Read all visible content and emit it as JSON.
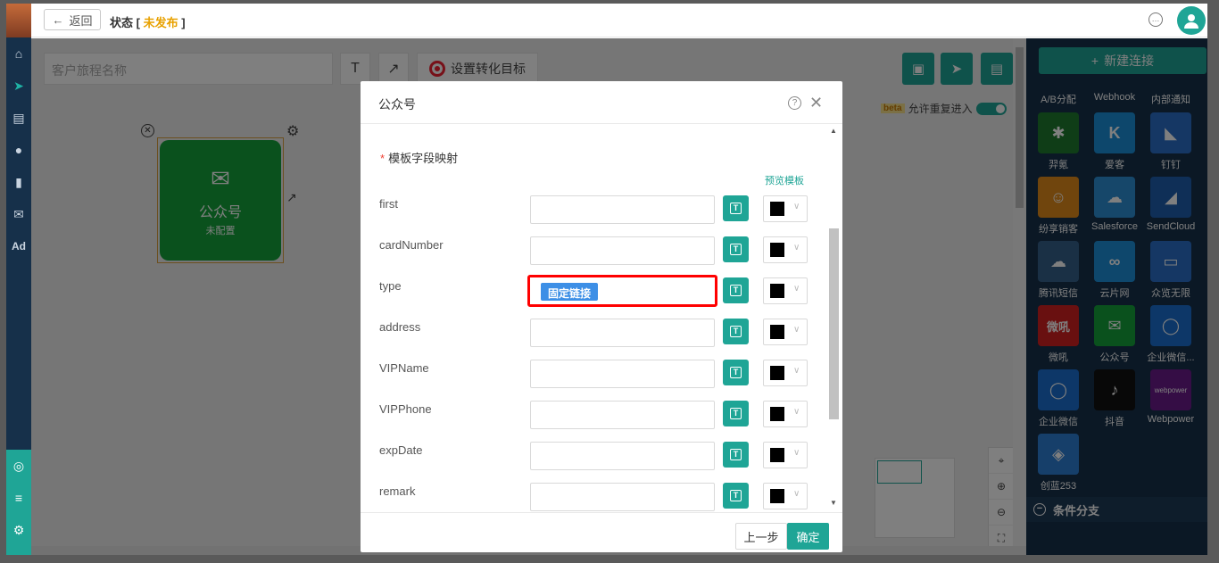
{
  "header": {
    "back_label": "返回",
    "status_prefix": "状态 [ ",
    "status_value": "未发布",
    "status_suffix": " ]"
  },
  "toolbar": {
    "journey_name_placeholder": "客户旅程名称",
    "text_tool": "T",
    "arrow_tool": "↗",
    "goal_label": "设置转化目标"
  },
  "canvas": {
    "beta": "beta",
    "allow_repeat": "允许重复进入",
    "node_title": "公众号",
    "node_status": "未配置"
  },
  "right_panel": {
    "new_connection": "新建连接",
    "top_row": [
      "A/B分配",
      "Webhook",
      "内部通知"
    ],
    "plugins": [
      {
        "label": "羿氪",
        "color": "#1e7a2e",
        "glyph": "✱"
      },
      {
        "label": "爱客",
        "color": "#1a8fd8",
        "glyph": "K"
      },
      {
        "label": "钉钉",
        "color": "#2a6fc9",
        "glyph": "◣"
      },
      {
        "label": "纷享销客",
        "color": "#e08a1a",
        "glyph": "☺"
      },
      {
        "label": "Salesforce",
        "color": "#2d8fd5",
        "glyph": "☁"
      },
      {
        "label": "SendCloud",
        "color": "#1f5fae",
        "glyph": "◢"
      },
      {
        "label": "腾讯短信",
        "color": "#35608a",
        "glyph": "☁"
      },
      {
        "label": "云片网",
        "color": "#1c8fd8",
        "glyph": "∞"
      },
      {
        "label": "众览无限",
        "color": "#2a6fc9",
        "glyph": "▭"
      },
      {
        "label": "微吼",
        "color": "#d32020",
        "glyph": "微吼"
      },
      {
        "label": "公众号",
        "color": "#14a33a",
        "glyph": "✉"
      },
      {
        "label": "企业微信...",
        "color": "#1a6fd0",
        "glyph": "◯"
      },
      {
        "label": "企业微信",
        "color": "#1a6fd0",
        "glyph": "◯"
      },
      {
        "label": "抖音",
        "color": "#111111",
        "glyph": "♪"
      },
      {
        "label": "Webpower",
        "color": "#6a1a8a",
        "glyph": "webpower"
      },
      {
        "label": "创蓝253",
        "color": "#2d7fd5",
        "glyph": "◈"
      }
    ],
    "branch_label": "条件分支"
  },
  "modal": {
    "title": "公众号",
    "section_title": "模板字段映射",
    "preview_link": "预览模板",
    "fields": [
      {
        "label": "first",
        "value": ""
      },
      {
        "label": "cardNumber",
        "value": ""
      },
      {
        "label": "type",
        "value": "固定链接"
      },
      {
        "label": "address",
        "value": ""
      },
      {
        "label": "VIPName",
        "value": ""
      },
      {
        "label": "VIPPhone",
        "value": ""
      },
      {
        "label": "expDate",
        "value": ""
      },
      {
        "label": "remark",
        "value": ""
      }
    ],
    "prev_button": "上一步",
    "confirm_button": "确定"
  },
  "colors": {
    "accent": "#1fa596",
    "nav": "#16304a",
    "highlight": "#ff0000",
    "tag": "#3d8fe6"
  }
}
